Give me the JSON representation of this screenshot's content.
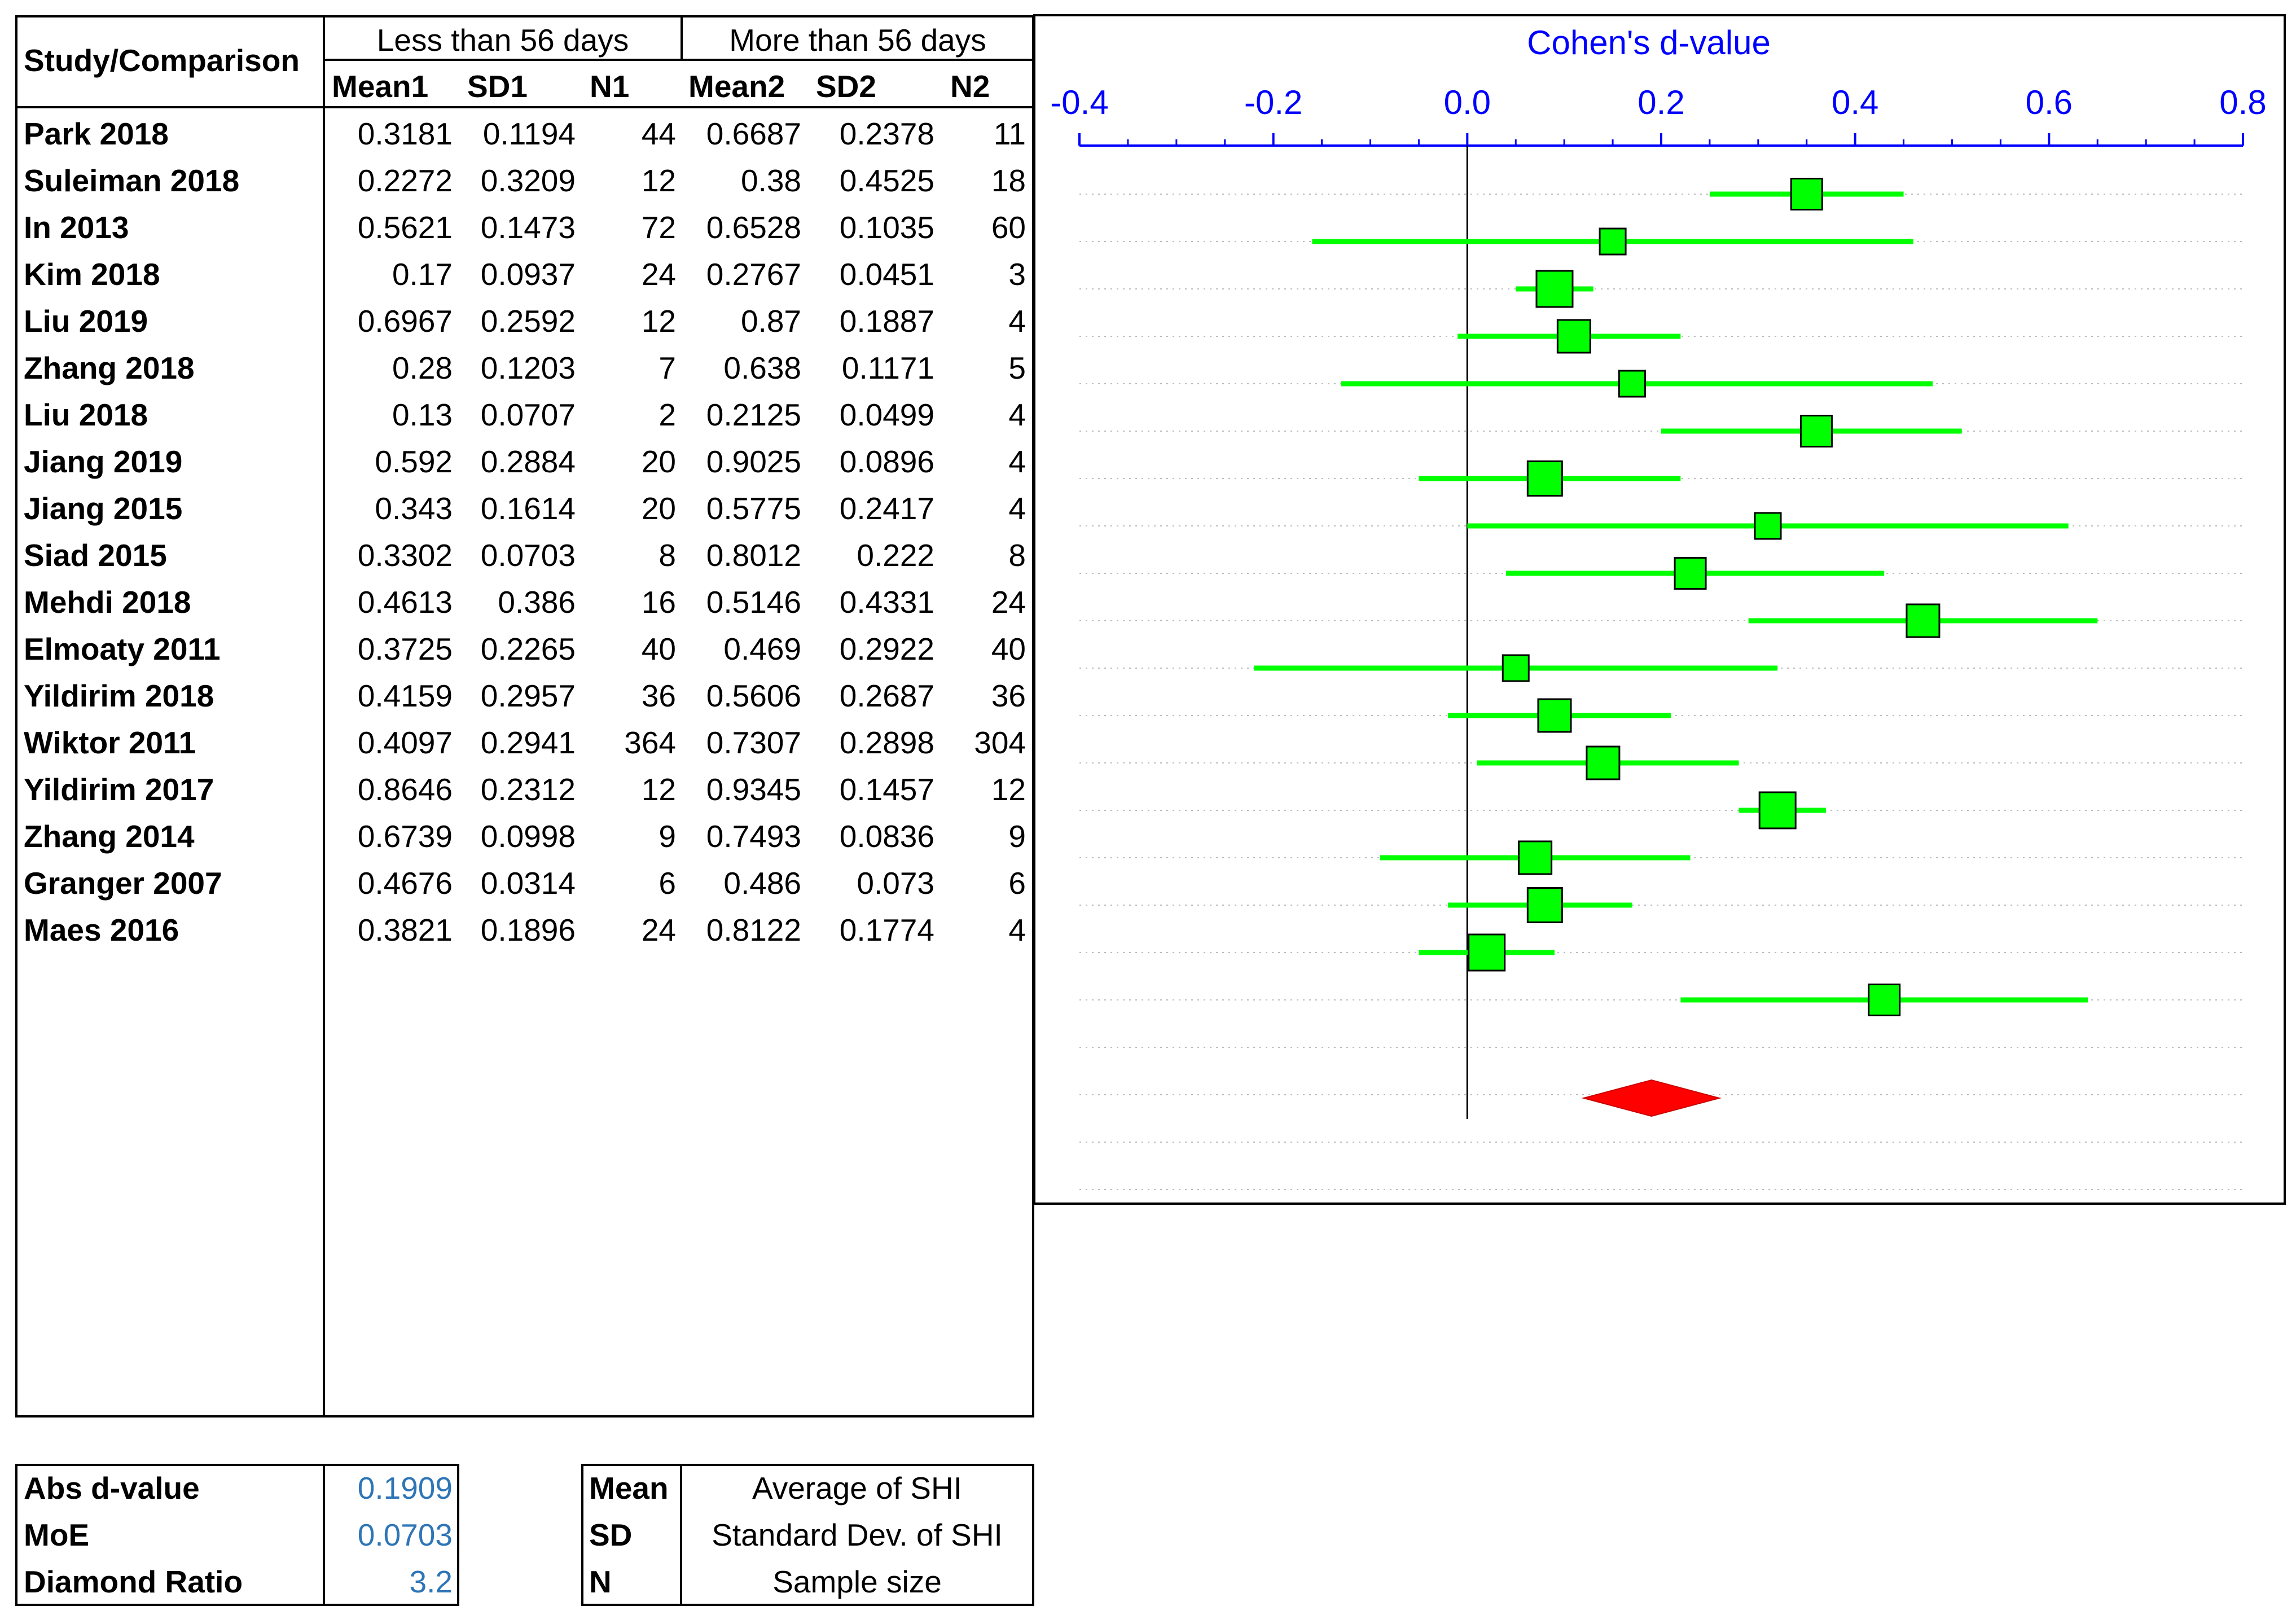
{
  "table": {
    "study_header": "Study/Comparison",
    "group1_header": "Less than 56 days",
    "group2_header": "More than 56 days",
    "col_headers": [
      "Mean1",
      "SD1",
      "N1",
      "Mean2",
      "SD2",
      "N2"
    ],
    "rows": [
      {
        "study": "Park 2018",
        "mean1": "0.3181",
        "sd1": "0.1194",
        "n1": "44",
        "mean2": "0.6687",
        "sd2": "0.2378",
        "n2": "11"
      },
      {
        "study": "Suleiman 2018",
        "mean1": "0.2272",
        "sd1": "0.3209",
        "n1": "12",
        "mean2": "0.38",
        "sd2": "0.4525",
        "n2": "18"
      },
      {
        "study": "In 2013",
        "mean1": "0.5621",
        "sd1": "0.1473",
        "n1": "72",
        "mean2": "0.6528",
        "sd2": "0.1035",
        "n2": "60"
      },
      {
        "study": "Kim 2018",
        "mean1": "0.17",
        "sd1": "0.0937",
        "n1": "24",
        "mean2": "0.2767",
        "sd2": "0.0451",
        "n2": "3"
      },
      {
        "study": "Liu 2019",
        "mean1": "0.6967",
        "sd1": "0.2592",
        "n1": "12",
        "mean2": "0.87",
        "sd2": "0.1887",
        "n2": "4"
      },
      {
        "study": "Zhang 2018",
        "mean1": "0.28",
        "sd1": "0.1203",
        "n1": "7",
        "mean2": "0.638",
        "sd2": "0.1171",
        "n2": "5"
      },
      {
        "study": "Liu 2018",
        "mean1": "0.13",
        "sd1": "0.0707",
        "n1": "2",
        "mean2": "0.2125",
        "sd2": "0.0499",
        "n2": "4"
      },
      {
        "study": "Jiang 2019",
        "mean1": "0.592",
        "sd1": "0.2884",
        "n1": "20",
        "mean2": "0.9025",
        "sd2": "0.0896",
        "n2": "4"
      },
      {
        "study": "Jiang 2015",
        "mean1": "0.343",
        "sd1": "0.1614",
        "n1": "20",
        "mean2": "0.5775",
        "sd2": "0.2417",
        "n2": "4"
      },
      {
        "study": "Siad 2015",
        "mean1": "0.3302",
        "sd1": "0.0703",
        "n1": "8",
        "mean2": "0.8012",
        "sd2": "0.222",
        "n2": "8"
      },
      {
        "study": "Mehdi 2018",
        "mean1": "0.4613",
        "sd1": "0.386",
        "n1": "16",
        "mean2": "0.5146",
        "sd2": "0.4331",
        "n2": "24"
      },
      {
        "study": "Elmoaty 2011",
        "mean1": "0.3725",
        "sd1": "0.2265",
        "n1": "40",
        "mean2": "0.469",
        "sd2": "0.2922",
        "n2": "40"
      },
      {
        "study": "Yildirim 2018",
        "mean1": "0.4159",
        "sd1": "0.2957",
        "n1": "36",
        "mean2": "0.5606",
        "sd2": "0.2687",
        "n2": "36"
      },
      {
        "study": "Wiktor 2011",
        "mean1": "0.4097",
        "sd1": "0.2941",
        "n1": "364",
        "mean2": "0.7307",
        "sd2": "0.2898",
        "n2": "304"
      },
      {
        "study": "Yildirim 2017",
        "mean1": "0.8646",
        "sd1": "0.2312",
        "n1": "12",
        "mean2": "0.9345",
        "sd2": "0.1457",
        "n2": "12"
      },
      {
        "study": "Zhang 2014",
        "mean1": "0.6739",
        "sd1": "0.0998",
        "n1": "9",
        "mean2": "0.7493",
        "sd2": "0.0836",
        "n2": "9"
      },
      {
        "study": "Granger 2007",
        "mean1": "0.4676",
        "sd1": "0.0314",
        "n1": "6",
        "mean2": "0.486",
        "sd2": "0.073",
        "n2": "6"
      },
      {
        "study": "Maes 2016",
        "mean1": "0.3821",
        "sd1": "0.1896",
        "n1": "24",
        "mean2": "0.8122",
        "sd2": "0.1774",
        "n2": "4"
      }
    ]
  },
  "summary": [
    {
      "label": "Abs d-value",
      "value": "0.1909"
    },
    {
      "label": "MoE",
      "value": "0.0703"
    },
    {
      "label": "Diamond Ratio",
      "value": "3.2"
    }
  ],
  "legend": [
    {
      "abbr": "Mean",
      "description": "Average of SHI"
    },
    {
      "abbr": "SD",
      "description": "Standard Dev. of SHI"
    },
    {
      "abbr": "N",
      "description": "Sample size"
    }
  ],
  "colors": {
    "axis": "#0000ff",
    "study_marker": "#00ff00",
    "summary_diamond": "#ff0000",
    "summary_values": "#2e75b6"
  },
  "chart_data": {
    "type": "forest",
    "title": "Cohen's d-value",
    "xlim": [
      -0.4,
      0.8
    ],
    "xticks": [
      "-0.4",
      "-0.2",
      "0.0",
      "0.2",
      "0.4",
      "0.6",
      "0.8"
    ],
    "tick_values": [
      -0.4,
      -0.2,
      0.0,
      0.2,
      0.4,
      0.6,
      0.8
    ],
    "studies": [
      {
        "name": "Park 2018",
        "d": 0.35,
        "lo": 0.25,
        "hi": 0.45,
        "weight": 0.7
      },
      {
        "name": "Suleiman 2018",
        "d": 0.15,
        "lo": -0.16,
        "hi": 0.46,
        "weight": 0.4
      },
      {
        "name": "In 2013",
        "d": 0.09,
        "lo": 0.05,
        "hi": 0.13,
        "weight": 1.0
      },
      {
        "name": "Kim 2018",
        "d": 0.11,
        "lo": -0.01,
        "hi": 0.22,
        "weight": 0.8
      },
      {
        "name": "Liu 2019",
        "d": 0.17,
        "lo": -0.13,
        "hi": 0.48,
        "weight": 0.4
      },
      {
        "name": "Zhang 2018",
        "d": 0.36,
        "lo": 0.2,
        "hi": 0.51,
        "weight": 0.7
      },
      {
        "name": "Liu 2018",
        "d": 0.08,
        "lo": -0.05,
        "hi": 0.22,
        "weight": 0.9
      },
      {
        "name": "Jiang 2019",
        "d": 0.31,
        "lo": 0.0,
        "hi": 0.62,
        "weight": 0.4
      },
      {
        "name": "Jiang 2015",
        "d": 0.23,
        "lo": 0.04,
        "hi": 0.43,
        "weight": 0.7
      },
      {
        "name": "Siad 2015",
        "d": 0.47,
        "lo": 0.29,
        "hi": 0.65,
        "weight": 0.8
      },
      {
        "name": "Mehdi 2018",
        "d": 0.05,
        "lo": -0.22,
        "hi": 0.32,
        "weight": 0.4
      },
      {
        "name": "Elmoaty 2011",
        "d": 0.09,
        "lo": -0.02,
        "hi": 0.21,
        "weight": 0.8
      },
      {
        "name": "Yildirim 2018",
        "d": 0.14,
        "lo": 0.01,
        "hi": 0.28,
        "weight": 0.8
      },
      {
        "name": "Wiktor 2011",
        "d": 0.32,
        "lo": 0.28,
        "hi": 0.37,
        "weight": 1.0
      },
      {
        "name": "Yildirim 2017",
        "d": 0.07,
        "lo": -0.09,
        "hi": 0.23,
        "weight": 0.8
      },
      {
        "name": "Zhang 2014",
        "d": 0.08,
        "lo": -0.02,
        "hi": 0.17,
        "weight": 0.9
      },
      {
        "name": "Granger 2007",
        "d": 0.02,
        "lo": -0.05,
        "hi": 0.09,
        "weight": 1.0
      },
      {
        "name": "Maes 2016",
        "d": 0.43,
        "lo": 0.22,
        "hi": 0.64,
        "weight": 0.7
      }
    ],
    "summary": {
      "d": 0.19,
      "lo": 0.12,
      "hi": 0.26
    }
  }
}
